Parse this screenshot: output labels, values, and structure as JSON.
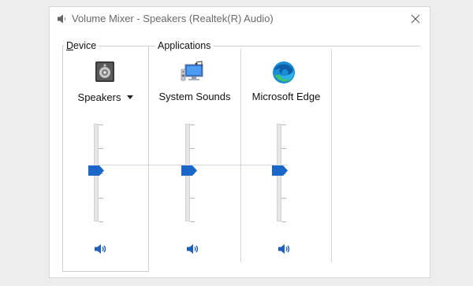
{
  "window": {
    "title": "Volume Mixer - Speakers (Realtek(R) Audio)"
  },
  "device_section": {
    "label_prefix": "D",
    "label_rest": "evice",
    "device_name": "Speakers",
    "volume_percent": 50,
    "icon": "speaker-device-icon"
  },
  "applications_section": {
    "label": "Applications",
    "apps": [
      {
        "name": "System Sounds",
        "volume_percent": 50,
        "icon": "system-sounds-icon"
      },
      {
        "name": "Microsoft Edge",
        "volume_percent": 50,
        "icon": "edge-icon"
      }
    ]
  },
  "colors": {
    "thumb": "#1b66c9",
    "mute_icon": "#1e5fb8",
    "border": "#cfcfcf"
  }
}
